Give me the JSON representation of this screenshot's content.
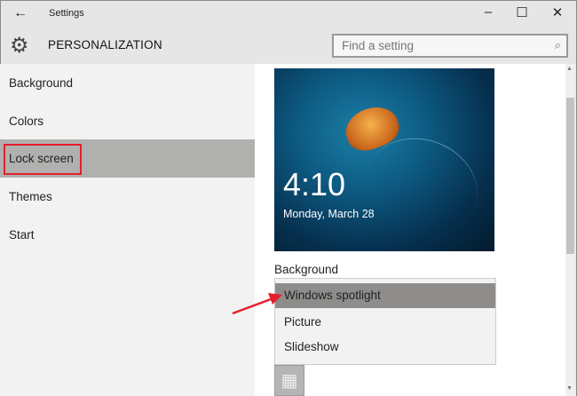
{
  "window": {
    "title": "Settings",
    "minimize": "–",
    "maximize": "☐",
    "close": "✕",
    "back": "←"
  },
  "header": {
    "title": "PERSONALIZATION",
    "search_placeholder": "Find a setting"
  },
  "sidebar": {
    "items": [
      {
        "label": "Background"
      },
      {
        "label": "Colors"
      },
      {
        "label": "Lock screen",
        "selected": true
      },
      {
        "label": "Themes"
      },
      {
        "label": "Start"
      }
    ]
  },
  "preview": {
    "time": "4:10",
    "date": "Monday, March 28"
  },
  "background": {
    "label": "Background",
    "options": [
      "Windows spotlight",
      "Picture",
      "Slideshow"
    ],
    "selected": "Windows spotlight"
  },
  "colors": {
    "accent": "#e3202b",
    "selected": "#b0b0ae"
  }
}
